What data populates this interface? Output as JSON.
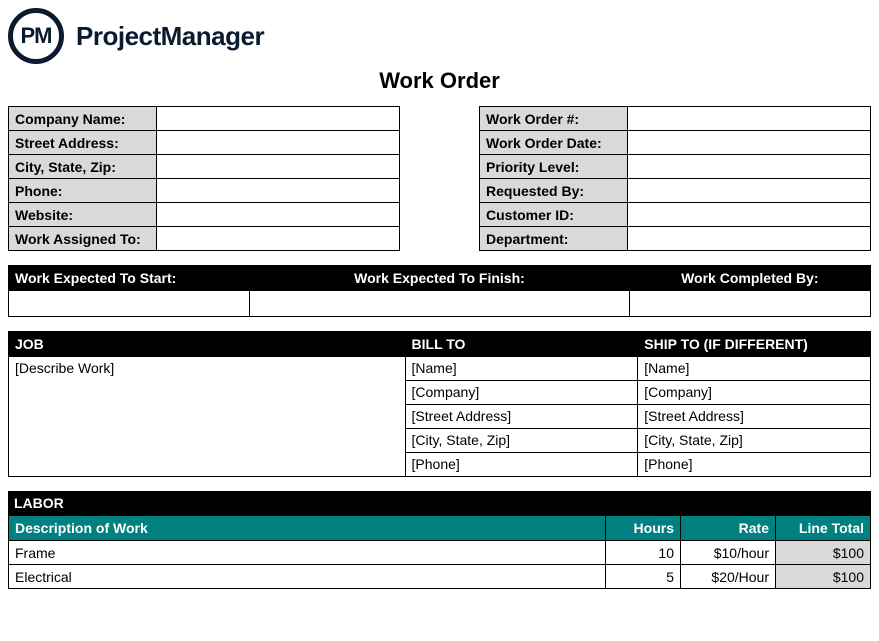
{
  "brand": {
    "logo_text": "PM",
    "name": "ProjectManager"
  },
  "title": "Work Order",
  "company_info": {
    "labels": {
      "company_name": "Company Name:",
      "street_address": "Street Address:",
      "city_state_zip": "City, State, Zip:",
      "phone": "Phone:",
      "website": "Website:",
      "work_assigned_to": "Work Assigned To:"
    },
    "values": {
      "company_name": "",
      "street_address": "",
      "city_state_zip": "",
      "phone": "",
      "website": "",
      "work_assigned_to": ""
    }
  },
  "order_info": {
    "labels": {
      "work_order_no": "Work Order #:",
      "work_order_date": "Work Order Date:",
      "priority_level": "Priority Level:",
      "requested_by": "Requested By:",
      "customer_id": "Customer ID:",
      "department": "Department:"
    },
    "values": {
      "work_order_no": "",
      "work_order_date": "",
      "priority_level": "",
      "requested_by": "",
      "customer_id": "",
      "department": ""
    }
  },
  "dates": {
    "labels": {
      "start": "Work Expected To Start:",
      "finish": "Work Expected To Finish:",
      "completed": "Work Completed By:"
    },
    "values": {
      "start": "",
      "finish": "",
      "completed": ""
    }
  },
  "job": {
    "headers": {
      "job": "JOB",
      "bill_to": "BILL TO",
      "ship_to": "SHIP TO (IF DIFFERENT)"
    },
    "describe": "[Describe Work]",
    "bill_to": [
      "[Name]",
      "[Company]",
      "[Street Address]",
      "[City, State, Zip]",
      "[Phone]"
    ],
    "ship_to": [
      "[Name]",
      "[Company]",
      "[Street Address]",
      "[City, State, Zip]",
      "[Phone]"
    ]
  },
  "labor": {
    "section_title": "LABOR",
    "headers": {
      "desc": "Description of Work",
      "hours": "Hours",
      "rate": "Rate",
      "total": "Line Total"
    },
    "rows": [
      {
        "desc": "Frame",
        "hours": "10",
        "rate": "$10/hour",
        "total": "$100"
      },
      {
        "desc": "Electrical",
        "hours": "5",
        "rate": "$20/Hour",
        "total": "$100"
      }
    ]
  }
}
